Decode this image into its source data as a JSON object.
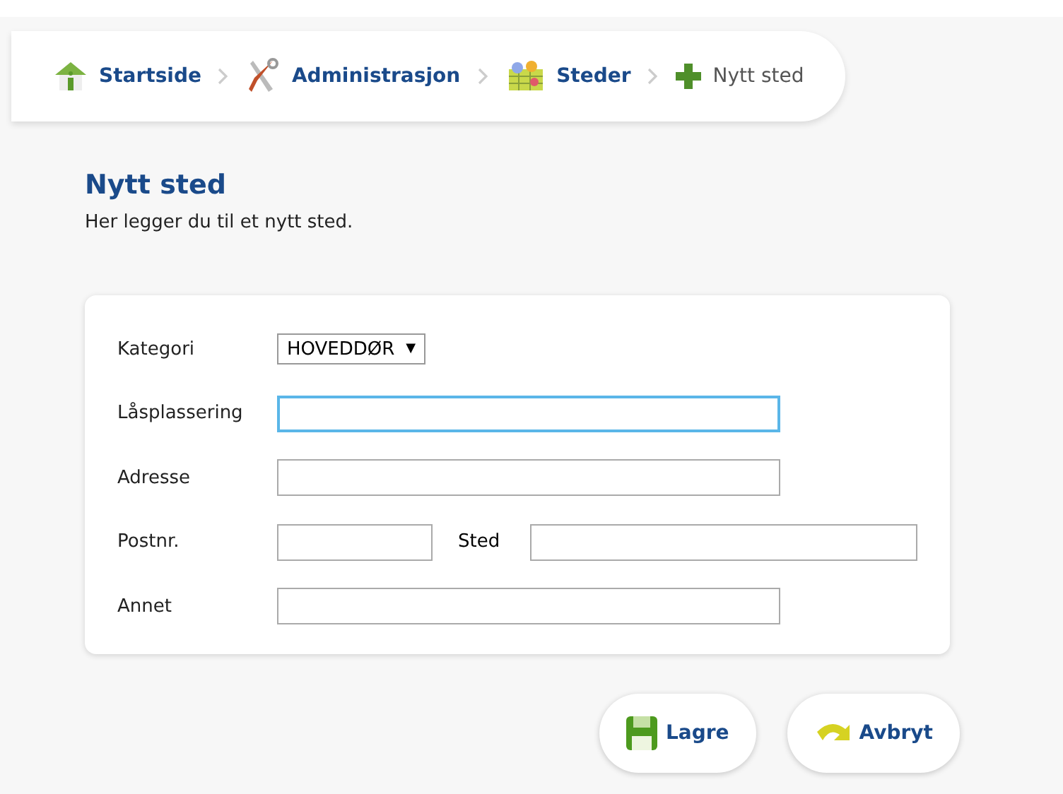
{
  "breadcrumb": [
    {
      "label": "Startside",
      "kind": "home",
      "current": false
    },
    {
      "label": "Administrasjon",
      "kind": "tools",
      "current": false
    },
    {
      "label": "Steder",
      "kind": "places",
      "current": false
    },
    {
      "label": "Nytt sted",
      "kind": "add",
      "current": true
    }
  ],
  "heading": "Nytt sted",
  "intro": "Her legger du til et nytt sted.",
  "form": {
    "rows": [
      {
        "kind": "select",
        "label": "Kategori",
        "value": "HOVEDDØR",
        "arrow": "▼"
      },
      {
        "kind": "text",
        "label": "Låsplassering",
        "focused": true
      },
      {
        "kind": "text",
        "label": "Adresse",
        "focused": false
      },
      {
        "kind": "pair",
        "label": "Postnr.",
        "label_2": "Sted"
      },
      {
        "kind": "text",
        "label": "Annet",
        "focused": false
      }
    ]
  },
  "buttons": [
    {
      "label": "Lagre",
      "kind": "save"
    },
    {
      "label": "Avbryt",
      "kind": "cancel"
    }
  ]
}
